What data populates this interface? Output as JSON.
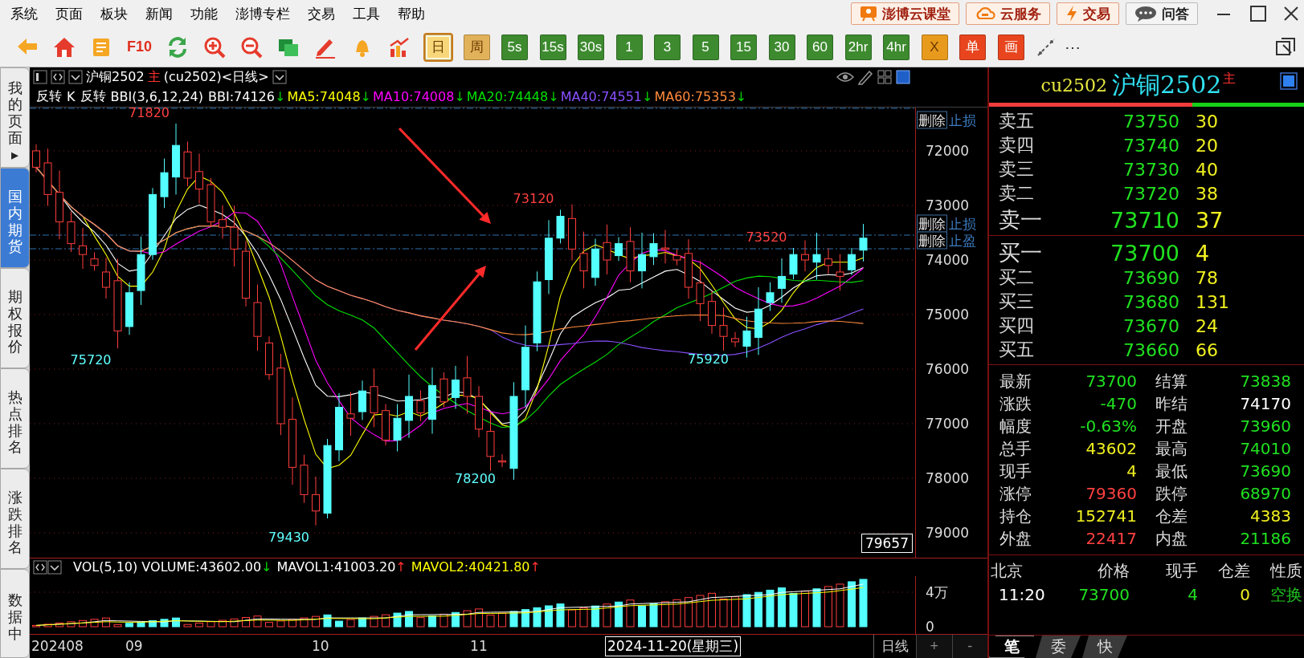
{
  "menu": {
    "items": [
      "系统",
      "页面",
      "板块",
      "新闻",
      "功能",
      "澎博专栏",
      "交易",
      "工具",
      "帮助"
    ],
    "buttons": [
      {
        "label": "澎博云课堂",
        "kind": "class"
      },
      {
        "label": "云服务",
        "kind": "cloud"
      },
      {
        "label": "交易",
        "kind": "trade"
      },
      {
        "label": "问答",
        "kind": "qa"
      }
    ]
  },
  "toolbar": {
    "f10": "F10",
    "periods": [
      {
        "label": "日",
        "color": "#f7d77a",
        "selected": true
      },
      {
        "label": "周",
        "color": "#e2b25a",
        "selected": false
      },
      {
        "label": "5s",
        "color": "#3d8a2f",
        "selected": false
      },
      {
        "label": "15s",
        "color": "#3d8a2f",
        "selected": false
      },
      {
        "label": "30s",
        "color": "#3d8a2f",
        "selected": false
      },
      {
        "label": "1",
        "color": "#3d8a2f",
        "selected": false
      },
      {
        "label": "3",
        "color": "#3d8a2f",
        "selected": false
      },
      {
        "label": "5",
        "color": "#3d8a2f",
        "selected": false
      },
      {
        "label": "15",
        "color": "#3d8a2f",
        "selected": false
      },
      {
        "label": "30",
        "color": "#3d8a2f",
        "selected": false
      },
      {
        "label": "60",
        "color": "#3d8a2f",
        "selected": false
      },
      {
        "label": "2hr",
        "color": "#3d8a2f",
        "selected": false
      },
      {
        "label": "4hr",
        "color": "#3d8a2f",
        "selected": false
      },
      {
        "label": "X",
        "color": "#e89a1c",
        "selected": false
      },
      {
        "label": "单",
        "color": "#e8451e",
        "selected": false
      },
      {
        "label": "画",
        "color": "#e8451e",
        "selected": false
      }
    ],
    "more": "⋯"
  },
  "sidebar": {
    "tabs": [
      {
        "label": "我的页面",
        "marker": "▸",
        "selected": false
      },
      {
        "label": "国内期货",
        "selected": true
      },
      {
        "label": "期权报价",
        "selected": false
      },
      {
        "label": "热点排名",
        "selected": false
      },
      {
        "label": "涨跌排名",
        "selected": false
      },
      {
        "label": "数据中",
        "selected": false
      }
    ]
  },
  "chart": {
    "title": "沪铜2502",
    "main_mark": "主",
    "code": "(cu2502)<日线>",
    "indicators": [
      {
        "text": "反转",
        "kind": "label",
        "color": "#ffffff"
      },
      {
        "text": "K",
        "kind": "label",
        "color": "#ffffff"
      },
      {
        "text": "反转",
        "kind": "label",
        "color": "#ffffff"
      },
      {
        "text": "BBI(3,6,12,24)",
        "kind": "label",
        "color": "#ffffff"
      },
      {
        "text": "BBI:74126",
        "kind": "value",
        "color": "#ffffff"
      },
      {
        "text": "↓",
        "kind": "arrow",
        "color": "#00d000"
      },
      {
        "text": "MA5:74048",
        "kind": "value",
        "color": "#ffff00"
      },
      {
        "text": "↓",
        "kind": "arrow",
        "color": "#00d000"
      },
      {
        "text": "MA10:74008",
        "kind": "value",
        "color": "#ff00ff"
      },
      {
        "text": "↓",
        "kind": "arrow",
        "color": "#00d000"
      },
      {
        "text": "MA20:74448",
        "kind": "value",
        "color": "#00e000"
      },
      {
        "text": "↓",
        "kind": "arrow",
        "color": "#00d000"
      },
      {
        "text": "MA40:74551",
        "kind": "value",
        "color": "#8a50ff"
      },
      {
        "text": "↓",
        "kind": "arrow",
        "color": "#00d000"
      },
      {
        "text": "MA60:75353",
        "kind": "value",
        "color": "#ff8a3c"
      },
      {
        "text": "↓",
        "kind": "arrow",
        "color": "#00d000"
      }
    ],
    "y_ticks": [
      "72000",
      "73000",
      "74000",
      "75000",
      "76000",
      "77000",
      "78000",
      "79000"
    ],
    "price_labels": [
      {
        "text": "71820",
        "kind": "high"
      },
      {
        "text": "75720",
        "kind": "low"
      },
      {
        "text": "79430",
        "kind": "low"
      },
      {
        "text": "78200",
        "kind": "low"
      },
      {
        "text": "73120",
        "kind": "high"
      },
      {
        "text": "75920",
        "kind": "low"
      },
      {
        "text": "73520",
        "kind": "high"
      }
    ],
    "order_lines": [
      {
        "button": "删除",
        "label": "止损"
      },
      {
        "button": "删除",
        "label": "止损"
      },
      {
        "button": "删除",
        "label": "止盈"
      }
    ],
    "cursor_price": "79657"
  },
  "volume": {
    "indicators": [
      {
        "text": "VOL(5,10) VOLUME:43602.00",
        "kind": "label",
        "color": "#ffffff"
      },
      {
        "text": "↓",
        "kind": "arrow",
        "color": "#00d000"
      },
      {
        "text": "MAVOL1:41003.20",
        "kind": "value",
        "color": "#ffffff"
      },
      {
        "text": "↑",
        "kind": "arrow",
        "color": "#ff3030"
      },
      {
        "text": "MAVOL2:40421.80",
        "kind": "value",
        "color": "#ffff00"
      },
      {
        "text": "↑",
        "kind": "arrow",
        "color": "#ff3030"
      }
    ],
    "y_ticks": [
      "4万",
      "0"
    ]
  },
  "x_axis": {
    "labels": [
      "202408",
      "09",
      "10",
      "11"
    ],
    "cursor_date": "2024-11-20(星期三)",
    "period": "日线",
    "zoom_in": "+",
    "zoom_out": "-"
  },
  "quote": {
    "code": "cu2502",
    "name": "沪铜2502",
    "main_mark": "主",
    "level": 0.645,
    "asks": [
      {
        "label": "卖五",
        "price": "73750",
        "volume": "30",
        "large": false
      },
      {
        "label": "卖四",
        "price": "73740",
        "volume": "20",
        "large": false
      },
      {
        "label": "卖三",
        "price": "73730",
        "volume": "40",
        "large": false
      },
      {
        "label": "卖二",
        "price": "73720",
        "volume": "38",
        "large": false
      },
      {
        "label": "卖一",
        "price": "73710",
        "volume": "37",
        "large": true
      }
    ],
    "bids": [
      {
        "label": "买一",
        "price": "73700",
        "volume": "4",
        "large": true
      },
      {
        "label": "买二",
        "price": "73690",
        "volume": "78",
        "large": false
      },
      {
        "label": "买三",
        "price": "73680",
        "volume": "131",
        "large": false
      },
      {
        "label": "买四",
        "price": "73670",
        "volume": "24",
        "large": false
      },
      {
        "label": "买五",
        "price": "73660",
        "volume": "66",
        "large": false
      }
    ],
    "stats": [
      {
        "label": "最新",
        "value": "73700",
        "color": "#20e020"
      },
      {
        "label": "结算",
        "value": "73838",
        "color": "#20e020"
      },
      {
        "label": "涨跌",
        "value": "-470",
        "color": "#20e020"
      },
      {
        "label": "昨结",
        "value": "74170",
        "color": "#ffffff"
      },
      {
        "label": "幅度",
        "value": "-0.63%",
        "color": "#20e020"
      },
      {
        "label": "开盘",
        "value": "73960",
        "color": "#20e020"
      },
      {
        "label": "总手",
        "value": "43602",
        "color": "#f0f020"
      },
      {
        "label": "最高",
        "value": "74010",
        "color": "#20e020"
      },
      {
        "label": "现手",
        "value": "4",
        "color": "#f0f020"
      },
      {
        "label": "最低",
        "value": "73690",
        "color": "#20e020"
      },
      {
        "label": "涨停",
        "value": "79360",
        "color": "#ff4040"
      },
      {
        "label": "跌停",
        "value": "68970",
        "color": "#20e020"
      },
      {
        "label": "持仓",
        "value": "152741",
        "color": "#f0f020"
      },
      {
        "label": "仓差",
        "value": "4383",
        "color": "#f0f020"
      },
      {
        "label": "外盘",
        "value": "22417",
        "color": "#ff4040"
      },
      {
        "label": "内盘",
        "value": "21186",
        "color": "#20e020"
      }
    ],
    "ticks": {
      "columns": [
        "北京",
        "价格",
        "现手",
        "仓差",
        "性质"
      ],
      "rows": [
        [
          {
            "text": "11:20",
            "color": "#ffffff"
          },
          {
            "text": "73700",
            "color": "#20e020"
          },
          {
            "text": "4",
            "color": "#20e020"
          },
          {
            "text": "0",
            "color": "#f0f020"
          },
          {
            "text": "空换",
            "color": "#20c020"
          }
        ]
      ]
    },
    "tabs": [
      {
        "label": "笔",
        "selected": true
      },
      {
        "label": "委",
        "selected": false
      },
      {
        "label": "快",
        "selected": false
      }
    ]
  }
}
